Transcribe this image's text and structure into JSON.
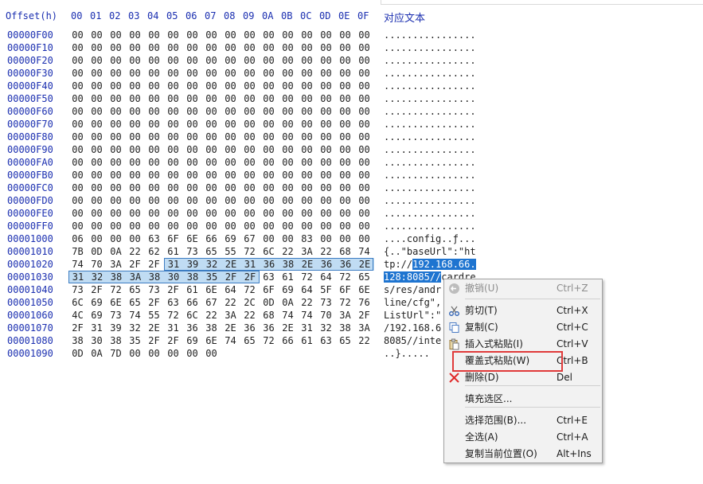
{
  "header": {
    "offset_label": "Offset(h)",
    "columns": [
      "00",
      "01",
      "02",
      "03",
      "04",
      "05",
      "06",
      "07",
      "08",
      "09",
      "0A",
      "0B",
      "0C",
      "0D",
      "0E",
      "0F"
    ],
    "text_label": "对应文本"
  },
  "rows": [
    {
      "offset": "00000F00",
      "bytes": [
        "00",
        "00",
        "00",
        "00",
        "00",
        "00",
        "00",
        "00",
        "00",
        "00",
        "00",
        "00",
        "00",
        "00",
        "00",
        "00"
      ],
      "text": "................"
    },
    {
      "offset": "00000F10",
      "bytes": [
        "00",
        "00",
        "00",
        "00",
        "00",
        "00",
        "00",
        "00",
        "00",
        "00",
        "00",
        "00",
        "00",
        "00",
        "00",
        "00"
      ],
      "text": "................"
    },
    {
      "offset": "00000F20",
      "bytes": [
        "00",
        "00",
        "00",
        "00",
        "00",
        "00",
        "00",
        "00",
        "00",
        "00",
        "00",
        "00",
        "00",
        "00",
        "00",
        "00"
      ],
      "text": "................"
    },
    {
      "offset": "00000F30",
      "bytes": [
        "00",
        "00",
        "00",
        "00",
        "00",
        "00",
        "00",
        "00",
        "00",
        "00",
        "00",
        "00",
        "00",
        "00",
        "00",
        "00"
      ],
      "text": "................"
    },
    {
      "offset": "00000F40",
      "bytes": [
        "00",
        "00",
        "00",
        "00",
        "00",
        "00",
        "00",
        "00",
        "00",
        "00",
        "00",
        "00",
        "00",
        "00",
        "00",
        "00"
      ],
      "text": "................"
    },
    {
      "offset": "00000F50",
      "bytes": [
        "00",
        "00",
        "00",
        "00",
        "00",
        "00",
        "00",
        "00",
        "00",
        "00",
        "00",
        "00",
        "00",
        "00",
        "00",
        "00"
      ],
      "text": "................"
    },
    {
      "offset": "00000F60",
      "bytes": [
        "00",
        "00",
        "00",
        "00",
        "00",
        "00",
        "00",
        "00",
        "00",
        "00",
        "00",
        "00",
        "00",
        "00",
        "00",
        "00"
      ],
      "text": "................"
    },
    {
      "offset": "00000F70",
      "bytes": [
        "00",
        "00",
        "00",
        "00",
        "00",
        "00",
        "00",
        "00",
        "00",
        "00",
        "00",
        "00",
        "00",
        "00",
        "00",
        "00"
      ],
      "text": "................"
    },
    {
      "offset": "00000F80",
      "bytes": [
        "00",
        "00",
        "00",
        "00",
        "00",
        "00",
        "00",
        "00",
        "00",
        "00",
        "00",
        "00",
        "00",
        "00",
        "00",
        "00"
      ],
      "text": "................"
    },
    {
      "offset": "00000F90",
      "bytes": [
        "00",
        "00",
        "00",
        "00",
        "00",
        "00",
        "00",
        "00",
        "00",
        "00",
        "00",
        "00",
        "00",
        "00",
        "00",
        "00"
      ],
      "text": "................"
    },
    {
      "offset": "00000FA0",
      "bytes": [
        "00",
        "00",
        "00",
        "00",
        "00",
        "00",
        "00",
        "00",
        "00",
        "00",
        "00",
        "00",
        "00",
        "00",
        "00",
        "00"
      ],
      "text": "................"
    },
    {
      "offset": "00000FB0",
      "bytes": [
        "00",
        "00",
        "00",
        "00",
        "00",
        "00",
        "00",
        "00",
        "00",
        "00",
        "00",
        "00",
        "00",
        "00",
        "00",
        "00"
      ],
      "text": "................"
    },
    {
      "offset": "00000FC0",
      "bytes": [
        "00",
        "00",
        "00",
        "00",
        "00",
        "00",
        "00",
        "00",
        "00",
        "00",
        "00",
        "00",
        "00",
        "00",
        "00",
        "00"
      ],
      "text": "................"
    },
    {
      "offset": "00000FD0",
      "bytes": [
        "00",
        "00",
        "00",
        "00",
        "00",
        "00",
        "00",
        "00",
        "00",
        "00",
        "00",
        "00",
        "00",
        "00",
        "00",
        "00"
      ],
      "text": "................"
    },
    {
      "offset": "00000FE0",
      "bytes": [
        "00",
        "00",
        "00",
        "00",
        "00",
        "00",
        "00",
        "00",
        "00",
        "00",
        "00",
        "00",
        "00",
        "00",
        "00",
        "00"
      ],
      "text": "................"
    },
    {
      "offset": "00000FF0",
      "bytes": [
        "00",
        "00",
        "00",
        "00",
        "00",
        "00",
        "00",
        "00",
        "00",
        "00",
        "00",
        "00",
        "00",
        "00",
        "00",
        "00"
      ],
      "text": "................"
    },
    {
      "offset": "00001000",
      "bytes": [
        "06",
        "00",
        "00",
        "00",
        "63",
        "6F",
        "6E",
        "66",
        "69",
        "67",
        "00",
        "00",
        "83",
        "00",
        "00",
        "00"
      ],
      "text": "....config..ƒ..."
    },
    {
      "offset": "00001010",
      "bytes": [
        "7B",
        "0D",
        "0A",
        "22",
        "62",
        "61",
        "73",
        "65",
        "55",
        "72",
        "6C",
        "22",
        "3A",
        "22",
        "68",
        "74"
      ],
      "text": "{..\"baseUrl\":\"ht"
    },
    {
      "offset": "00001020",
      "bytes": [
        "74",
        "70",
        "3A",
        "2F",
        "2F",
        "31",
        "39",
        "32",
        "2E",
        "31",
        "36",
        "38",
        "2E",
        "36",
        "36",
        "2E"
      ],
      "text": "tp://192.168.66."
    },
    {
      "offset": "00001030",
      "bytes": [
        "31",
        "32",
        "38",
        "3A",
        "38",
        "30",
        "38",
        "35",
        "2F",
        "2F",
        "63",
        "61",
        "72",
        "64",
        "72",
        "65"
      ],
      "text": "128:8085//cardre"
    },
    {
      "offset": "00001040",
      "bytes": [
        "73",
        "2F",
        "72",
        "65",
        "73",
        "2F",
        "61",
        "6E",
        "64",
        "72",
        "6F",
        "69",
        "64",
        "5F",
        "6F",
        "6E"
      ],
      "text": "s/res/andr"
    },
    {
      "offset": "00001050",
      "bytes": [
        "6C",
        "69",
        "6E",
        "65",
        "2F",
        "63",
        "66",
        "67",
        "22",
        "2C",
        "0D",
        "0A",
        "22",
        "73",
        "72",
        "76"
      ],
      "text": "line/cfg\","
    },
    {
      "offset": "00001060",
      "bytes": [
        "4C",
        "69",
        "73",
        "74",
        "55",
        "72",
        "6C",
        "22",
        "3A",
        "22",
        "68",
        "74",
        "74",
        "70",
        "3A",
        "2F"
      ],
      "text": "ListUrl\":\""
    },
    {
      "offset": "00001070",
      "bytes": [
        "2F",
        "31",
        "39",
        "32",
        "2E",
        "31",
        "36",
        "38",
        "2E",
        "36",
        "36",
        "2E",
        "31",
        "32",
        "38",
        "3A"
      ],
      "text": "/192.168.6"
    },
    {
      "offset": "00001080",
      "bytes": [
        "38",
        "30",
        "38",
        "35",
        "2F",
        "2F",
        "69",
        "6E",
        "74",
        "65",
        "72",
        "66",
        "61",
        "63",
        "65",
        "22"
      ],
      "text": "8085//inte"
    },
    {
      "offset": "00001090",
      "bytes": [
        "0D",
        "0A",
        "7D",
        "00",
        "00",
        "00",
        "00",
        "00"
      ],
      "text": "..}....."
    }
  ],
  "context_menu": {
    "items": [
      {
        "label": "撤销(U)",
        "shortcut": "Ctrl+Z",
        "icon": "undo-icon",
        "disabled": true
      },
      {
        "label": "剪切(T)",
        "shortcut": "Ctrl+X",
        "icon": "scissors-icon",
        "disabled": false
      },
      {
        "label": "复制(C)",
        "shortcut": "Ctrl+C",
        "icon": "copy-icon",
        "disabled": false
      },
      {
        "label": "插入式粘贴(I)",
        "shortcut": "Ctrl+V",
        "icon": "paste-icon",
        "disabled": false
      },
      {
        "label": "覆盖式粘贴(W)",
        "shortcut": "Ctrl+B",
        "icon": "",
        "disabled": false
      },
      {
        "label": "删除(D)",
        "shortcut": "Del",
        "icon": "delete-icon",
        "disabled": false
      },
      {
        "label": "填充选区...",
        "shortcut": "",
        "icon": "",
        "disabled": false
      },
      {
        "label": "选择范围(B)...",
        "shortcut": "Ctrl+E",
        "icon": "",
        "disabled": false
      },
      {
        "label": "全选(A)",
        "shortcut": "Ctrl+A",
        "icon": "",
        "disabled": false
      },
      {
        "label": "复制当前位置(O)",
        "shortcut": "Alt+Ins",
        "icon": "",
        "disabled": false
      }
    ]
  },
  "colors": {
    "offset_blue": "#1b2fb0",
    "selection_fill": "#c0dcf3",
    "text_selection": "#1e74d0",
    "highlight_red": "#e03a3a"
  }
}
